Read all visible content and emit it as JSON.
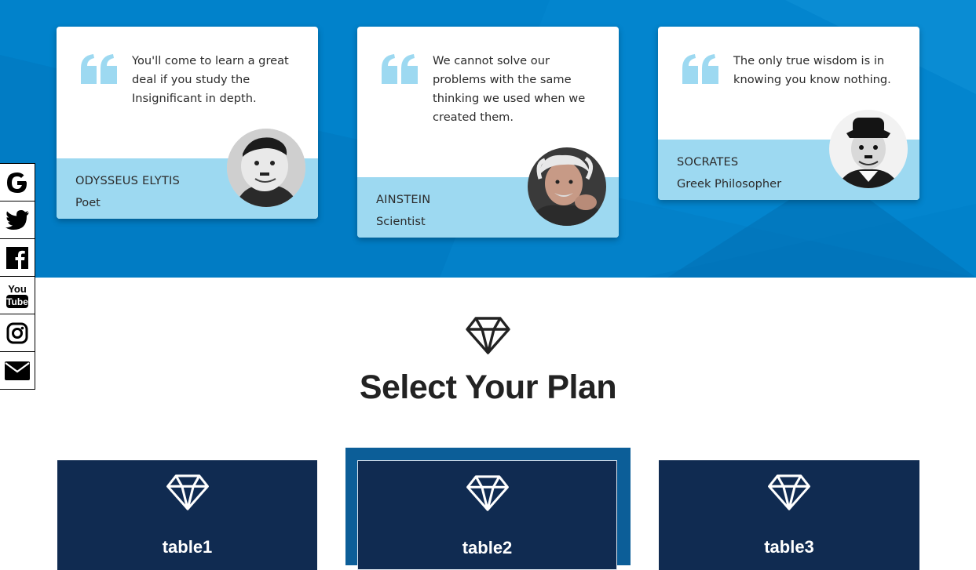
{
  "testimonials": [
    {
      "quote": "You'll come to learn a great deal if you study the Insignificant in depth.",
      "author": "ODYSSEUS ELYTIS",
      "role": "Poet"
    },
    {
      "quote": "We cannot solve our problems with the same thinking we used when we created them.",
      "author": "AINSTEIN",
      "role": "Scientist"
    },
    {
      "quote": "The only true wisdom is in knowing you know nothing.",
      "author": "SOCRATES",
      "role": "Greek Philosopher"
    }
  ],
  "social": [
    {
      "icon": "google-icon"
    },
    {
      "icon": "twitter-icon"
    },
    {
      "icon": "facebook-icon"
    },
    {
      "icon": "youtube-icon"
    },
    {
      "icon": "instagram-icon"
    },
    {
      "icon": "email-icon"
    }
  ],
  "plans_section": {
    "title": "Select Your Plan",
    "plans": [
      {
        "name": "table1"
      },
      {
        "name": "table2"
      },
      {
        "name": "table3"
      }
    ]
  },
  "colors": {
    "band_blue": "#0182cb",
    "card_footer": "#9dd9f1",
    "quote_mark": "#9dd9f1",
    "plan_navy": "#102b51",
    "featured_frame": "#0c5e98"
  }
}
